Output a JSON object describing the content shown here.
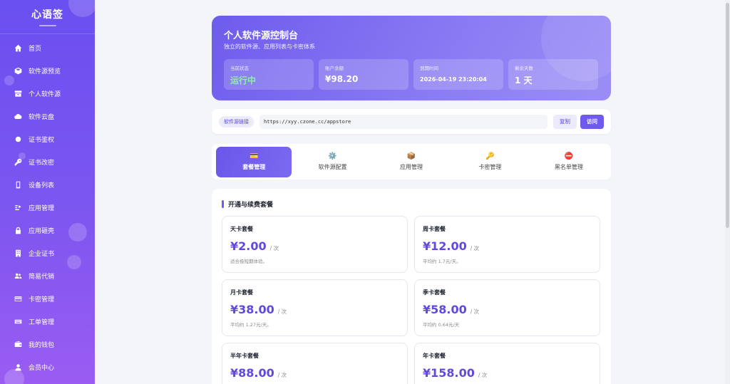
{
  "brand": {
    "title": "心语签"
  },
  "sidebar": {
    "items": [
      {
        "label": "首页",
        "icon": "home-icon"
      },
      {
        "label": "软件源预览",
        "icon": "box-icon"
      },
      {
        "label": "个人软件源",
        "icon": "archive-icon"
      },
      {
        "label": "软件云盘",
        "icon": "cloud-icon"
      },
      {
        "label": "证书鉴权",
        "icon": "gear-icon"
      },
      {
        "label": "证书改密",
        "icon": "key-icon"
      },
      {
        "label": "设备列表",
        "icon": "phone-icon"
      },
      {
        "label": "应用管理",
        "icon": "apps-icon"
      },
      {
        "label": "应用砸壳",
        "icon": "lock-icon"
      },
      {
        "label": "企业证书",
        "icon": "building-icon"
      },
      {
        "label": "简易代销",
        "icon": "users-icon"
      },
      {
        "label": "卡密管理",
        "icon": "card-icon"
      },
      {
        "label": "工单管理",
        "icon": "keyboard-icon"
      },
      {
        "label": "我的钱包",
        "icon": "wallet-icon"
      },
      {
        "label": "会员中心",
        "icon": "user-icon"
      }
    ]
  },
  "hero": {
    "title": "个人软件源控制台",
    "subtitle": "独立的软件源、应用列表与卡密体系",
    "stats": [
      {
        "label": "当前状态",
        "value": "运行中"
      },
      {
        "label": "账户余额",
        "value": "¥98.20"
      },
      {
        "label": "到期时间",
        "value": "2026-04-19 23:20:04"
      },
      {
        "label": "剩余天数",
        "value": "1 天"
      }
    ]
  },
  "source_link": {
    "tag": "软件源链接",
    "url": "https://xyy.czone.cc/appstore",
    "copy_label": "复制",
    "visit_label": "访问"
  },
  "tabs": [
    {
      "label": "套餐管理",
      "icon": "💳",
      "active": true
    },
    {
      "label": "软件源配置",
      "icon": "⚙️",
      "active": false
    },
    {
      "label": "应用管理",
      "icon": "📦",
      "active": false
    },
    {
      "label": "卡密管理",
      "icon": "🔑",
      "active": false
    },
    {
      "label": "黑名单管理",
      "icon": "⛔",
      "active": false
    }
  ],
  "packages": {
    "title": "开通与续费套餐",
    "items": [
      {
        "name": "天卡套餐",
        "price": "¥2.00",
        "unit": "/ 次",
        "desc": "适合极短期体验。"
      },
      {
        "name": "周卡套餐",
        "price": "¥12.00",
        "unit": "/ 次",
        "desc": "平均约 1.7元/天。"
      },
      {
        "name": "月卡套餐",
        "price": "¥38.00",
        "unit": "/ 次",
        "desc": "平均约 1.27元/天。"
      },
      {
        "name": "季卡套餐",
        "price": "¥58.00",
        "unit": "/ 次",
        "desc": "平均约 0.64元/天"
      },
      {
        "name": "半年卡套餐",
        "price": "¥88.00",
        "unit": "/ 次",
        "desc": ""
      },
      {
        "name": "年卡套餐",
        "price": "¥158.00",
        "unit": "/ 次",
        "desc": ""
      }
    ]
  },
  "colors": {
    "accent": "#6d5cec",
    "price": "#6248e0",
    "running": "#8ff0a4"
  }
}
